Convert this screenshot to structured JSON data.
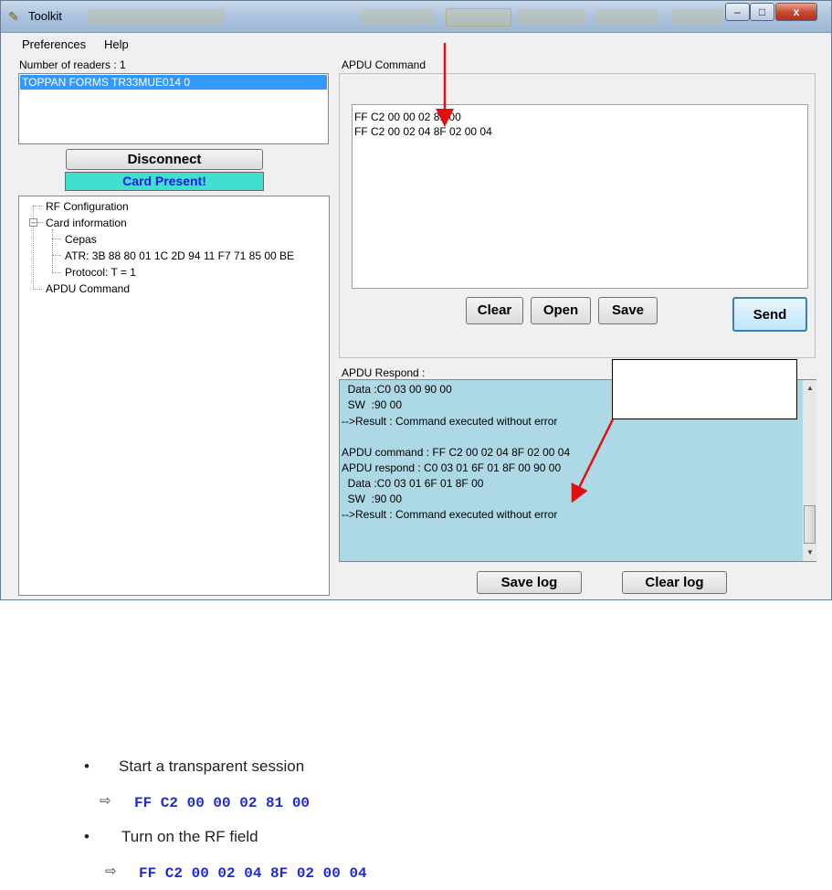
{
  "window": {
    "title": "Toolkit",
    "controls": {
      "minimize": "–",
      "maximize": "□",
      "close": "x"
    }
  },
  "menu": [
    "Preferences",
    "Help"
  ],
  "readers": {
    "count_label": "Number of readers : 1",
    "items": [
      "TOPPAN FORMS TR33MUE014 0"
    ]
  },
  "buttons": {
    "disconnect": "Disconnect",
    "clear": "Clear",
    "open": "Open",
    "save": "Save",
    "send": "Send",
    "save_log": "Save log",
    "clear_log": "Clear log"
  },
  "card_status": "Card Present!",
  "tree": {
    "rf_configuration": "RF Configuration",
    "card_information": "Card information",
    "cepas": "Cepas",
    "atr": "ATR: 3B 88 80 01 1C 2D 94 11 F7 71 85 00 BE",
    "protocol": "Protocol: T = 1",
    "apdu_command": "APDU Command"
  },
  "apdu_command": {
    "label": "APDU Command",
    "lines": [
      "FF C2 00 00 02 81 00",
      "FF C2 00 02 04 8F 02 00 04"
    ]
  },
  "apdu_respond": {
    "label": "APDU Respond :",
    "lines": [
      "  Data :C0 03 00 90 00",
      "  SW  :90 00",
      "-->Result : Command executed without error",
      "",
      "APDU command : FF C2 00 02 04 8F 02 00 04",
      "APDU respond : C0 03 01 6F 01 8F 00 90 00",
      "  Data :C0 03 01 6F 01 8F 00",
      "  SW  :90 00",
      "-->Result : Command executed without error"
    ]
  },
  "doc": {
    "bullets": [
      {
        "text": "Start a transparent session",
        "code": "FF C2 00 00 02 81 00"
      },
      {
        "text": "Turn on the RF field",
        "code": "FF C2 00 02 04 8F 02 00 04"
      }
    ],
    "bullet_char": "•",
    "arrow_char": "⇨"
  },
  "colors": {
    "card_present_bg": "#40e0d0",
    "card_present_text": "#1a1adf",
    "respond_bg": "#add8e6",
    "selection": "#3399ff",
    "code_text": "#1f2ad0",
    "annotation_arrow": "#e01010"
  }
}
